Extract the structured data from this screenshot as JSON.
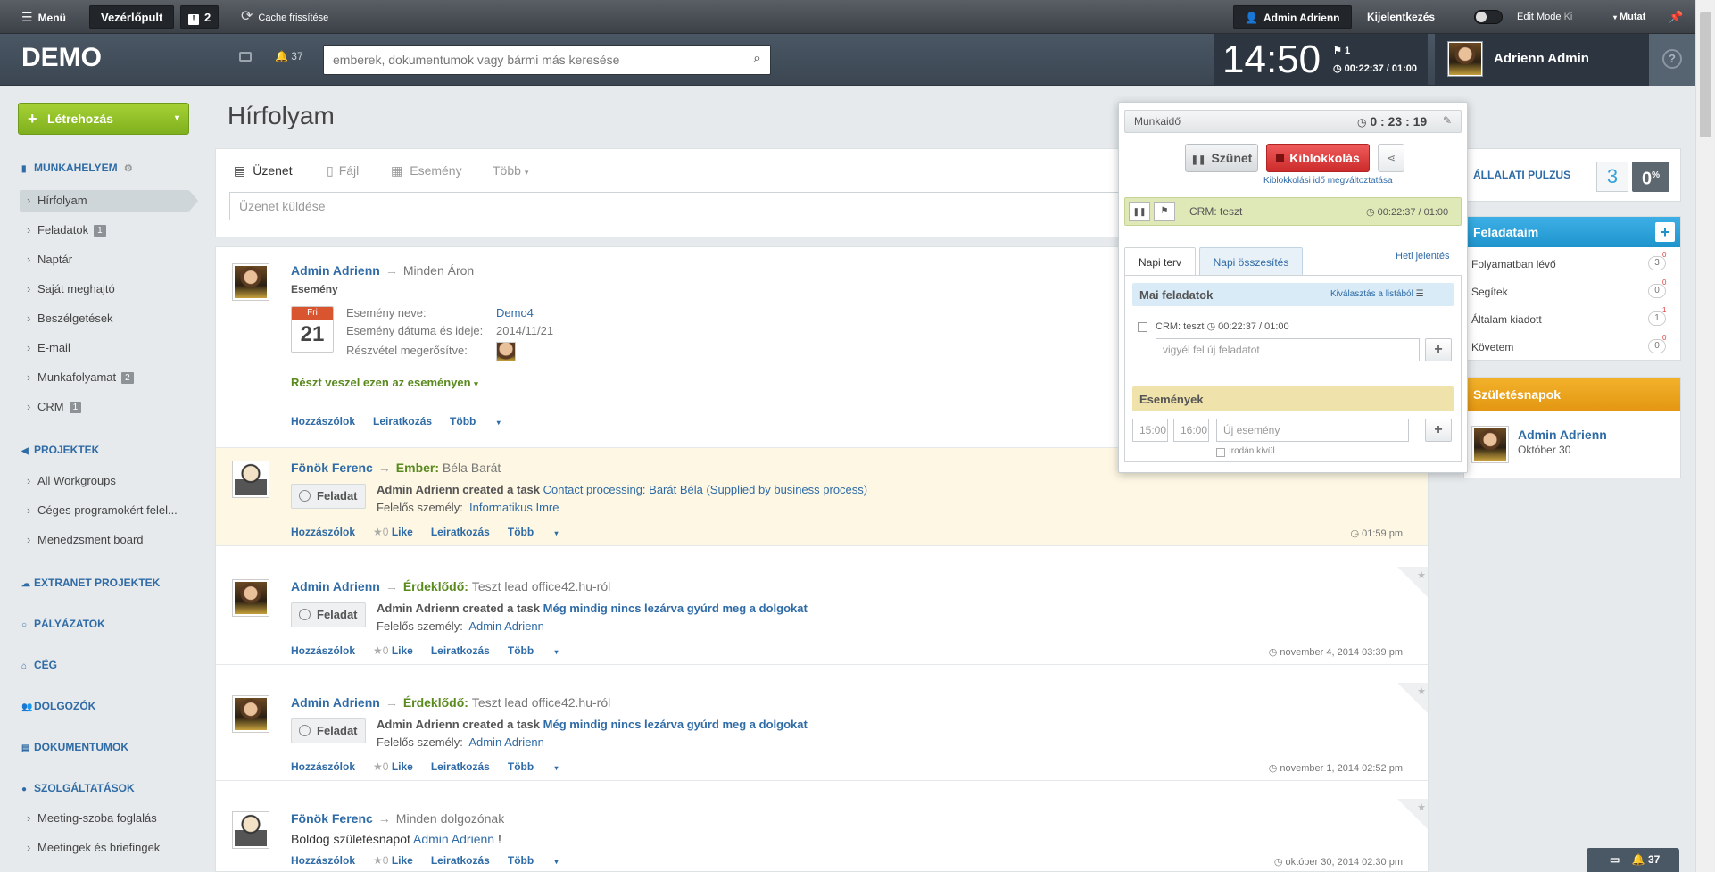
{
  "adminbar": {
    "menu_label": "Menü",
    "dashboard_label": "Vezérlőpult",
    "notif_count": "2",
    "cache_label": "Cache frissítése",
    "user_label": "Admin Adrienn",
    "logout_label": "Kijelentkezés",
    "editmode_label": "Edit Mode",
    "editmode_state": "Ki",
    "show_label": "Mutat"
  },
  "header": {
    "logo": "DEMO",
    "notif_count": "37",
    "search_placeholder": "emberek, dokumentumok vagy bármi más keresése",
    "clock_time": "14:50",
    "flag_count": "1",
    "work_timer": "00:22:37 / 01:00",
    "user_name": "Adrienn Admin",
    "help": "?"
  },
  "sidebar": {
    "create_label": "Létrehozás",
    "sections": {
      "workplace": "MUNKAHELYEM",
      "projects": "PROJEKTEK",
      "extranet": "EXTRANET PROJEKTEK",
      "tenders": "PÁLYÁZATOK",
      "company": "CÉG",
      "employees": "DOLGOZÓK",
      "documents": "DOKUMENTUMOK",
      "services": "SZOLGÁLTATÁSOK"
    },
    "workplace_items": [
      {
        "label": "Hírfolyam",
        "count": ""
      },
      {
        "label": "Feladatok",
        "count": "1"
      },
      {
        "label": "Naptár",
        "count": ""
      },
      {
        "label": "Saját meghajtó",
        "count": ""
      },
      {
        "label": "Beszélgetések",
        "count": ""
      },
      {
        "label": "E-mail",
        "count": ""
      },
      {
        "label": "Munkafolyamat",
        "count": "2"
      },
      {
        "label": "CRM",
        "count": "1"
      }
    ],
    "project_items": [
      "All Workgroups",
      "Céges programokért felel...",
      "Menedzsment board"
    ],
    "service_items": [
      "Meeting-szoba foglalás",
      "Meetingek és briefingek"
    ]
  },
  "main": {
    "title": "Hírfolyam",
    "tabs": {
      "message": "Üzenet",
      "file": "Fájl",
      "event": "Esemény",
      "more": "Több"
    },
    "message_placeholder": "Üzenet küldése"
  },
  "posts": {
    "p1": {
      "author": "Admin Adrienn",
      "target": "Minden Áron",
      "type": "Esemény",
      "event_name_label": "Esemény neve:",
      "event_name": "Demo4",
      "event_date_label": "Esemény dátuma és ideje:",
      "event_date": "2014/11/21",
      "confirm_label": "Részvétel megerősítve:",
      "cal_day": "Fri",
      "cal_num": "21",
      "attend_label": "Részt veszel ezen az eseményen",
      "comments": "Hozzászólok",
      "unsubscribe": "Leiratkozás",
      "more": "Több"
    },
    "p2": {
      "author": "Fönök Ferenc",
      "target_prefix": "Ember:",
      "target": "Béla Barát",
      "badge": "Feladat",
      "text_prefix": "Admin Adrienn created a task",
      "task_link": "Contact processing: Barát Béla (Supplied by business process)",
      "resp_label": "Felelős személy:",
      "resp": "Informatikus Imre",
      "comments": "Hozzászólok",
      "likes": "0",
      "like": "Like",
      "unsubscribe": "Leiratkozás",
      "more": "Több",
      "time": "01:59 pm"
    },
    "p3": {
      "author": "Admin Adrienn",
      "target_prefix": "Érdeklődő:",
      "target": "Teszt lead office42.hu-ról",
      "badge": "Feladat",
      "text_prefix": "Admin Adrienn created a task",
      "task_link": "Még mindig nincs lezárva gyúrd meg a dolgokat",
      "resp_label": "Felelős személy:",
      "resp": "Admin Adrienn",
      "comments": "Hozzászólok",
      "likes": "0",
      "like": "Like",
      "unsubscribe": "Leiratkozás",
      "more": "Több",
      "time": "november 4, 2014 03:39 pm"
    },
    "p4": {
      "author": "Admin Adrienn",
      "target_prefix": "Érdeklődő:",
      "target": "Teszt lead office42.hu-ról",
      "badge": "Feladat",
      "text_prefix": "Admin Adrienn created a task",
      "task_link": "Még mindig nincs lezárva gyúrd meg a dolgokat",
      "resp_label": "Felelős személy:",
      "resp": "Admin Adrienn",
      "comments": "Hozzászólok",
      "likes": "0",
      "like": "Like",
      "unsubscribe": "Leiratkozás",
      "more": "Több",
      "time": "november 1, 2014 02:52 pm"
    },
    "p5": {
      "author": "Fönök Ferenc",
      "target": "Minden dolgozónak",
      "text_prefix": "Boldog születésnapot",
      "mention": "Admin Adrienn",
      "text_suffix": "!",
      "comments": "Hozzászólok",
      "likes": "0",
      "like": "Like",
      "unsubscribe": "Leiratkozás",
      "more": "Több",
      "time": "október 30, 2014 02:30 pm"
    }
  },
  "right": {
    "pulse_title": "ÁLLALATI PULZUS",
    "pulse_num": "3",
    "pulse_pct": "0",
    "pulse_pct_sign": "%",
    "tasks_title": "Feladataim",
    "tasks": [
      {
        "label": "Folyamatban lévő",
        "count": "3",
        "badge": "0"
      },
      {
        "label": "Segítek",
        "count": "0",
        "badge": "0"
      },
      {
        "label": "Általam kiadott",
        "count": "1",
        "badge": "1"
      },
      {
        "label": "Követem",
        "count": "0",
        "badge": "0"
      }
    ],
    "birthdays_title": "Születésnapok",
    "bday_name": "Admin Adrienn",
    "bday_date": "Október 30"
  },
  "popup": {
    "worktime_label": "Munkaidő",
    "worktime": "0 : 23 : 19",
    "pause_label": "Szünet",
    "clockout_label": "Kiblokkolás",
    "change_link": "Kiblokkolási idő megváltoztatása",
    "crm_task": "CRM: teszt",
    "crm_timer": "00:22:37 / 01:00",
    "tab_plan": "Napi terv",
    "tab_summary": "Napi összesítés",
    "weekly_link": "Heti jelentés",
    "daily_tasks": "Mai feladatok",
    "pick_from_list": "Kiválasztás a listából",
    "task_item": "CRM: teszt",
    "task_timer": "00:22:37 / 01:00",
    "new_task_placeholder": "vigyél fel új feladatot",
    "events_title": "Események",
    "time_from": "15:00",
    "time_to": "16:00",
    "new_event_placeholder": "Új esemény",
    "out_of_office": "Irodán kívül"
  },
  "chat": {
    "count": "37"
  }
}
